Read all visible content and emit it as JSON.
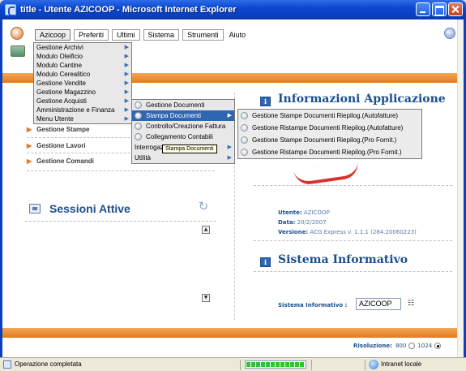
{
  "window": {
    "title": "title - Utente AZICOOP - Microsoft Internet Explorer"
  },
  "menubar": {
    "items": [
      "Azicoop",
      "Preferiti",
      "Ultimi",
      "Sistema",
      "Strumenti",
      "Aiuto"
    ]
  },
  "dropdown_azicoop": {
    "items": [
      {
        "label": "Gestione Archivi",
        "has_submenu": true
      },
      {
        "label": "Modulo Oleificio",
        "has_submenu": true
      },
      {
        "label": "Modulo Cantine",
        "has_submenu": true
      },
      {
        "label": "Modulo Cerealitico",
        "has_submenu": true
      },
      {
        "label": "Gestione Vendite",
        "has_submenu": true
      },
      {
        "label": "Gestione Magazzino",
        "has_submenu": true
      },
      {
        "label": "Gestione Acquisti",
        "has_submenu": true
      },
      {
        "label": "Amministrazione e Finanza",
        "has_submenu": true
      },
      {
        "label": "Menu Utente",
        "has_submenu": true
      }
    ]
  },
  "dropdown_level2": {
    "items": [
      {
        "label": "Gestione Documenti",
        "has_submenu": false
      },
      {
        "label": "Stampa Documenti",
        "has_submenu": true,
        "highlighted": true
      },
      {
        "label": "Controllo/Creazione Fattura",
        "has_submenu": false
      },
      {
        "label": "Collegamento Contabili",
        "has_submenu": false
      },
      {
        "label": "Interrogazioni e Statistiche",
        "has_submenu": true
      },
      {
        "label": "Utilità",
        "has_submenu": true
      }
    ]
  },
  "dropdown_level3": {
    "items": [
      "Gestione Stampe Documenti Riepilog.(Autofatture)",
      "Gestione Ristampe Documenti Riepilog.(Autofatture)",
      "Gestione Stampe Documenti Riepilog.(Pro Fornit.)",
      "Gestione Ristampe Documenti Riepilog.(Pro Fornit.)"
    ]
  },
  "tooltip": "Stampa Documenti",
  "left_panel": {
    "links": [
      "Gestione Stampe",
      "Gestione Lavori",
      "Gestione Comandi"
    ],
    "sessions_title": "Sessioni Attive"
  },
  "right_panel": {
    "info_title": "Informazioni Applicazione",
    "utente_label": "Utente:",
    "utente_value": "AZICOOP",
    "data_label": "Data:",
    "data_value": "20/2/2007",
    "versione_label": "Versione:",
    "versione_value": "ACG Express v. 1.1.1 (284.20060223)",
    "sistema_title": "Sistema Informativo",
    "sistema_label": "Sistema Informativo :",
    "sistema_value": "AZICOOP"
  },
  "resolution": {
    "label": "Risoluzione:",
    "options": [
      "800",
      "1024"
    ],
    "selected": "1024"
  },
  "statusbar": {
    "status": "Operazione completata",
    "zone": "Intranet locale",
    "progress": 1.0
  }
}
